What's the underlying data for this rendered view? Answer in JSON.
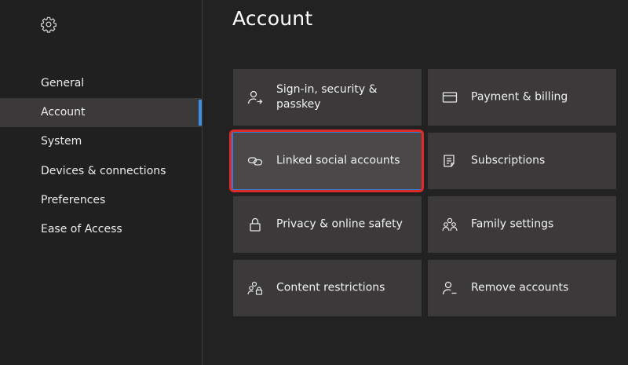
{
  "page_title": "Account",
  "sidebar": {
    "settings_icon": "gear-icon",
    "items": [
      {
        "label": "General"
      },
      {
        "label": "Account",
        "active": true
      },
      {
        "label": "System"
      },
      {
        "label": "Devices & connections"
      },
      {
        "label": "Preferences"
      },
      {
        "label": "Ease of Access"
      }
    ]
  },
  "tiles": {
    "signin": {
      "label": "Sign-in, security & passkey",
      "icon": "person-arrow-icon"
    },
    "payment": {
      "label": "Payment & billing",
      "icon": "credit-card-icon"
    },
    "linked": {
      "label": "Linked social accounts",
      "icon": "link-icon",
      "focused": true
    },
    "subscriptions": {
      "label": "Subscriptions",
      "icon": "document-list-icon"
    },
    "privacy": {
      "label": "Privacy & online safety",
      "icon": "lock-icon"
    },
    "family": {
      "label": "Family settings",
      "icon": "family-icon"
    },
    "content": {
      "label": "Content restrictions",
      "icon": "people-lock-icon"
    },
    "remove": {
      "label": "Remove accounts",
      "icon": "person-minus-icon"
    }
  },
  "colors": {
    "background": "#222222",
    "sidebar": "#202020",
    "tile": "#3b3939",
    "accent": "#3a8fe8",
    "highlight": "#e02a2a"
  }
}
